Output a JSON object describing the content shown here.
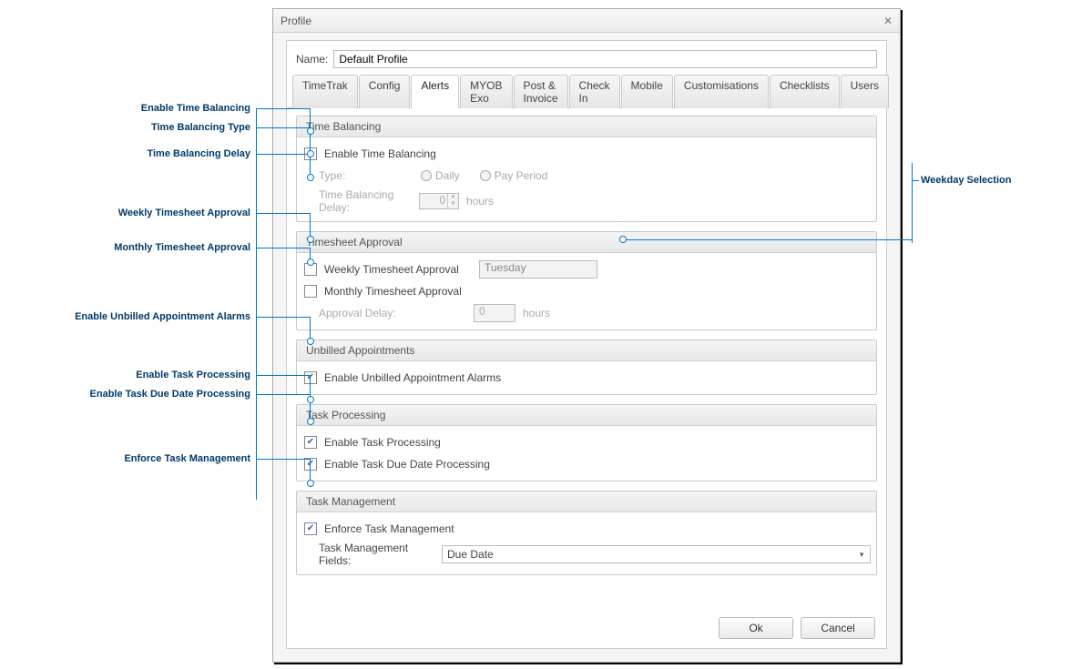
{
  "window": {
    "title": "Profile"
  },
  "name": {
    "label": "Name:",
    "value": "Default Profile"
  },
  "tabs": [
    {
      "label": "TimeTrak"
    },
    {
      "label": "Config"
    },
    {
      "label": "Alerts"
    },
    {
      "label": "MYOB Exo"
    },
    {
      "label": "Post & Invoice"
    },
    {
      "label": "Check In"
    },
    {
      "label": "Mobile"
    },
    {
      "label": "Customisations"
    },
    {
      "label": "Checklists"
    },
    {
      "label": "Users"
    }
  ],
  "groups": {
    "timeBalancing": {
      "title": "Time Balancing",
      "enable": "Enable Time Balancing",
      "typeLabel": "Type:",
      "daily": "Daily",
      "payPeriod": "Pay Period",
      "delayLabel": "Time Balancing Delay:",
      "delayValue": "0",
      "hours": "hours"
    },
    "timesheet": {
      "title": "Timesheet Approval",
      "weekly": "Weekly Timesheet Approval",
      "weekday": "Tuesday",
      "monthly": "Monthly Timesheet Approval",
      "approvalDelayLabel": "Approval Delay:",
      "approvalDelayValue": "0",
      "hours": "hours"
    },
    "unbilled": {
      "title": "Unbilled Appointments",
      "enable": "Enable Unbilled Appointment Alarms"
    },
    "taskProc": {
      "title": "Task Processing",
      "enableProc": "Enable Task Processing",
      "enableDue": "Enable Task Due Date Processing"
    },
    "taskMgmt": {
      "title": "Task Management",
      "enforce": "Enforce Task Management",
      "fieldsLabel": "Task Management Fields:",
      "fieldsValue": "Due Date"
    }
  },
  "buttons": {
    "ok": "Ok",
    "cancel": "Cancel"
  },
  "callouts": {
    "c1": "Enable Time Balancing",
    "c2": "Time Balancing Type",
    "c3": "Time Balancing Delay",
    "c4": "Weekly Timesheet Approval",
    "c5": "Monthly Timesheet Approval",
    "c6": "Enable Unbilled Appointment Alarms",
    "c7": "Enable Task Processing",
    "c8": "Enable Task Due Date Processing",
    "c9": "Enforce Task Management",
    "c10": "Weekday Selection"
  }
}
